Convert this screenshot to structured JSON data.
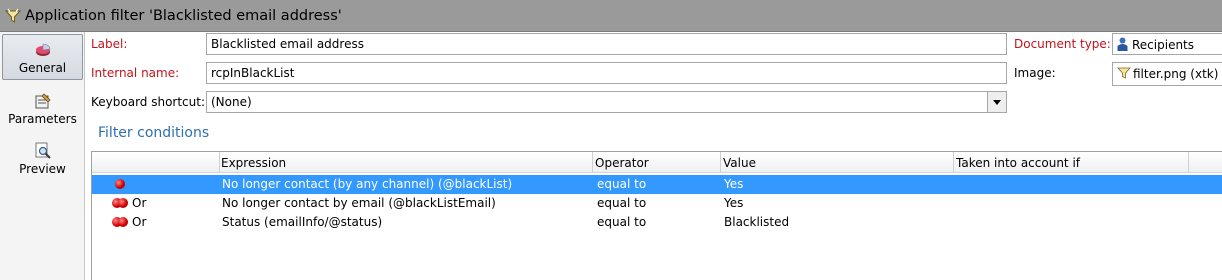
{
  "window": {
    "title": "Application filter 'Blacklisted email address'"
  },
  "sidebar": {
    "items": [
      {
        "label": "General",
        "icon": "pie-chart-icon",
        "active": true
      },
      {
        "label": "Parameters",
        "icon": "parameters-icon",
        "active": false
      },
      {
        "label": "Preview",
        "icon": "preview-magnifier-icon",
        "active": false
      }
    ]
  },
  "form": {
    "label": {
      "label": "Label:",
      "value": "Blacklisted email address"
    },
    "internal_name": {
      "label": "Internal name:",
      "value": "rcpInBlackList"
    },
    "keyboard_shortcut": {
      "label": "Keyboard shortcut:",
      "value": "(None)"
    },
    "document_type": {
      "label": "Document type:",
      "value": "Recipients"
    },
    "image": {
      "label": "Image:",
      "value": "filter.png (xtk)"
    }
  },
  "filter_conditions": {
    "title": "Filter conditions",
    "columns": [
      "Expression",
      "Operator",
      "Value",
      "Taken into account if"
    ],
    "rows": [
      {
        "prefix": "",
        "expression": "No longer contact (by any channel) (@blackList)",
        "operator": "equal to",
        "value": "Yes",
        "condition": "",
        "selected": true
      },
      {
        "prefix": "Or",
        "expression": "No longer contact by email (@blackListEmail)",
        "operator": "equal to",
        "value": "Yes",
        "condition": "",
        "selected": false
      },
      {
        "prefix": "Or",
        "expression": "Status (emailInfo/@status)",
        "operator": "equal to",
        "value": "Blacklisted",
        "condition": "",
        "selected": false
      }
    ]
  },
  "colors": {
    "required_label": "#c0141c",
    "section_title": "#2f6fb0",
    "selection": "#3399ff",
    "titlebar": "#9a9a9a"
  }
}
